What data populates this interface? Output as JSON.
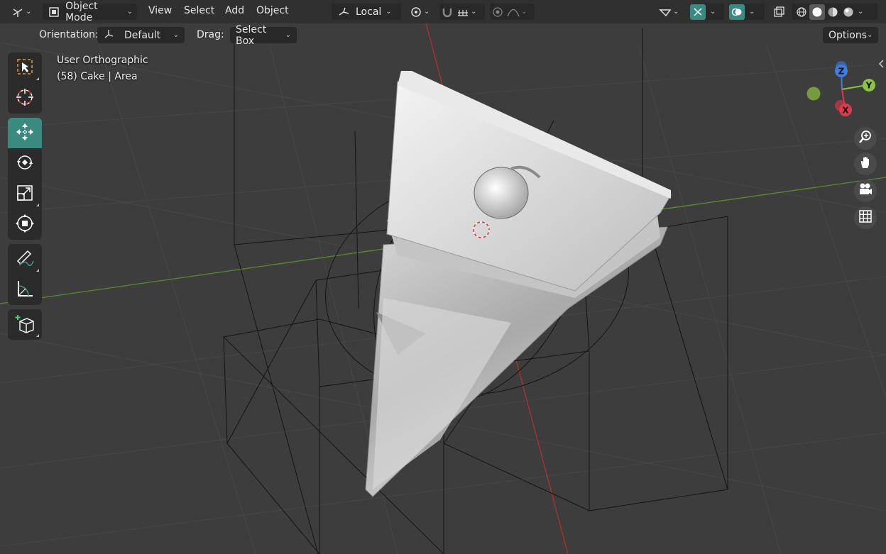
{
  "header": {
    "editor_type_icon": "viewport-editor-icon",
    "mode": {
      "icon": "object-mode-icon",
      "label": "Object Mode"
    },
    "menus": [
      "View",
      "Select",
      "Add",
      "Object"
    ],
    "transform_orientation": {
      "icon": "local-axes-icon",
      "label": "Local"
    },
    "pivot_icon": "pivot-point-icon",
    "snap_icon": "snap-magnet-icon",
    "snap_target_icon": "snap-increment-icon",
    "proportional_icon": "proportional-edit-icon",
    "falloff_icon": "falloff-curve-icon",
    "visibility_icon": "object-visibility-icon",
    "gizmo_icon": "gizmo-toggle-icon",
    "overlay_icon": "overlay-toggle-icon",
    "xray_icon": "xray-toggle-icon",
    "shading_modes": [
      "wireframe-shading-icon",
      "solid-shading-icon",
      "material-shading-icon",
      "rendered-shading-icon"
    ]
  },
  "tool_settings": {
    "orientation_label": "Orientation:",
    "orientation_value": "Default",
    "drag_label": "Drag:",
    "drag_value": "Select Box",
    "options_label": "Options"
  },
  "overlay": {
    "view_name": "User Orthographic",
    "object_info": "(58) Cake | Area"
  },
  "toolbar": {
    "tools": [
      {
        "name": "select-box-tool",
        "icon": "select-box-icon",
        "active": false
      },
      {
        "name": "cursor-tool",
        "icon": "cursor-icon",
        "active": false
      },
      {
        "name": "move-tool",
        "icon": "move-icon",
        "active": true
      },
      {
        "name": "rotate-tool",
        "icon": "rotate-icon",
        "active": false
      },
      {
        "name": "scale-tool",
        "icon": "scale-icon",
        "active": false
      },
      {
        "name": "transform-tool",
        "icon": "transform-icon",
        "active": false
      },
      {
        "name": "annotate-tool",
        "icon": "annotate-icon",
        "active": false
      },
      {
        "name": "measure-tool",
        "icon": "measure-icon",
        "active": false
      },
      {
        "name": "add-cube-tool",
        "icon": "add-cube-icon",
        "active": false
      }
    ]
  },
  "gizmo": {
    "axes": [
      "Z",
      "Y",
      "X"
    ],
    "colors": {
      "x": "#e0394b",
      "y": "#8bc43f",
      "z": "#3b7fe0"
    }
  },
  "nav_buttons": [
    "zoom-icon",
    "pan-hand-icon",
    "camera-view-icon",
    "ortho-grid-icon"
  ],
  "colors": {
    "accent": "#3a8a82",
    "header_bg": "#303030",
    "viewport_bg": "#3d3d3d",
    "x_axis_line": "#b03030",
    "y_axis_line": "#5a8a2a"
  }
}
